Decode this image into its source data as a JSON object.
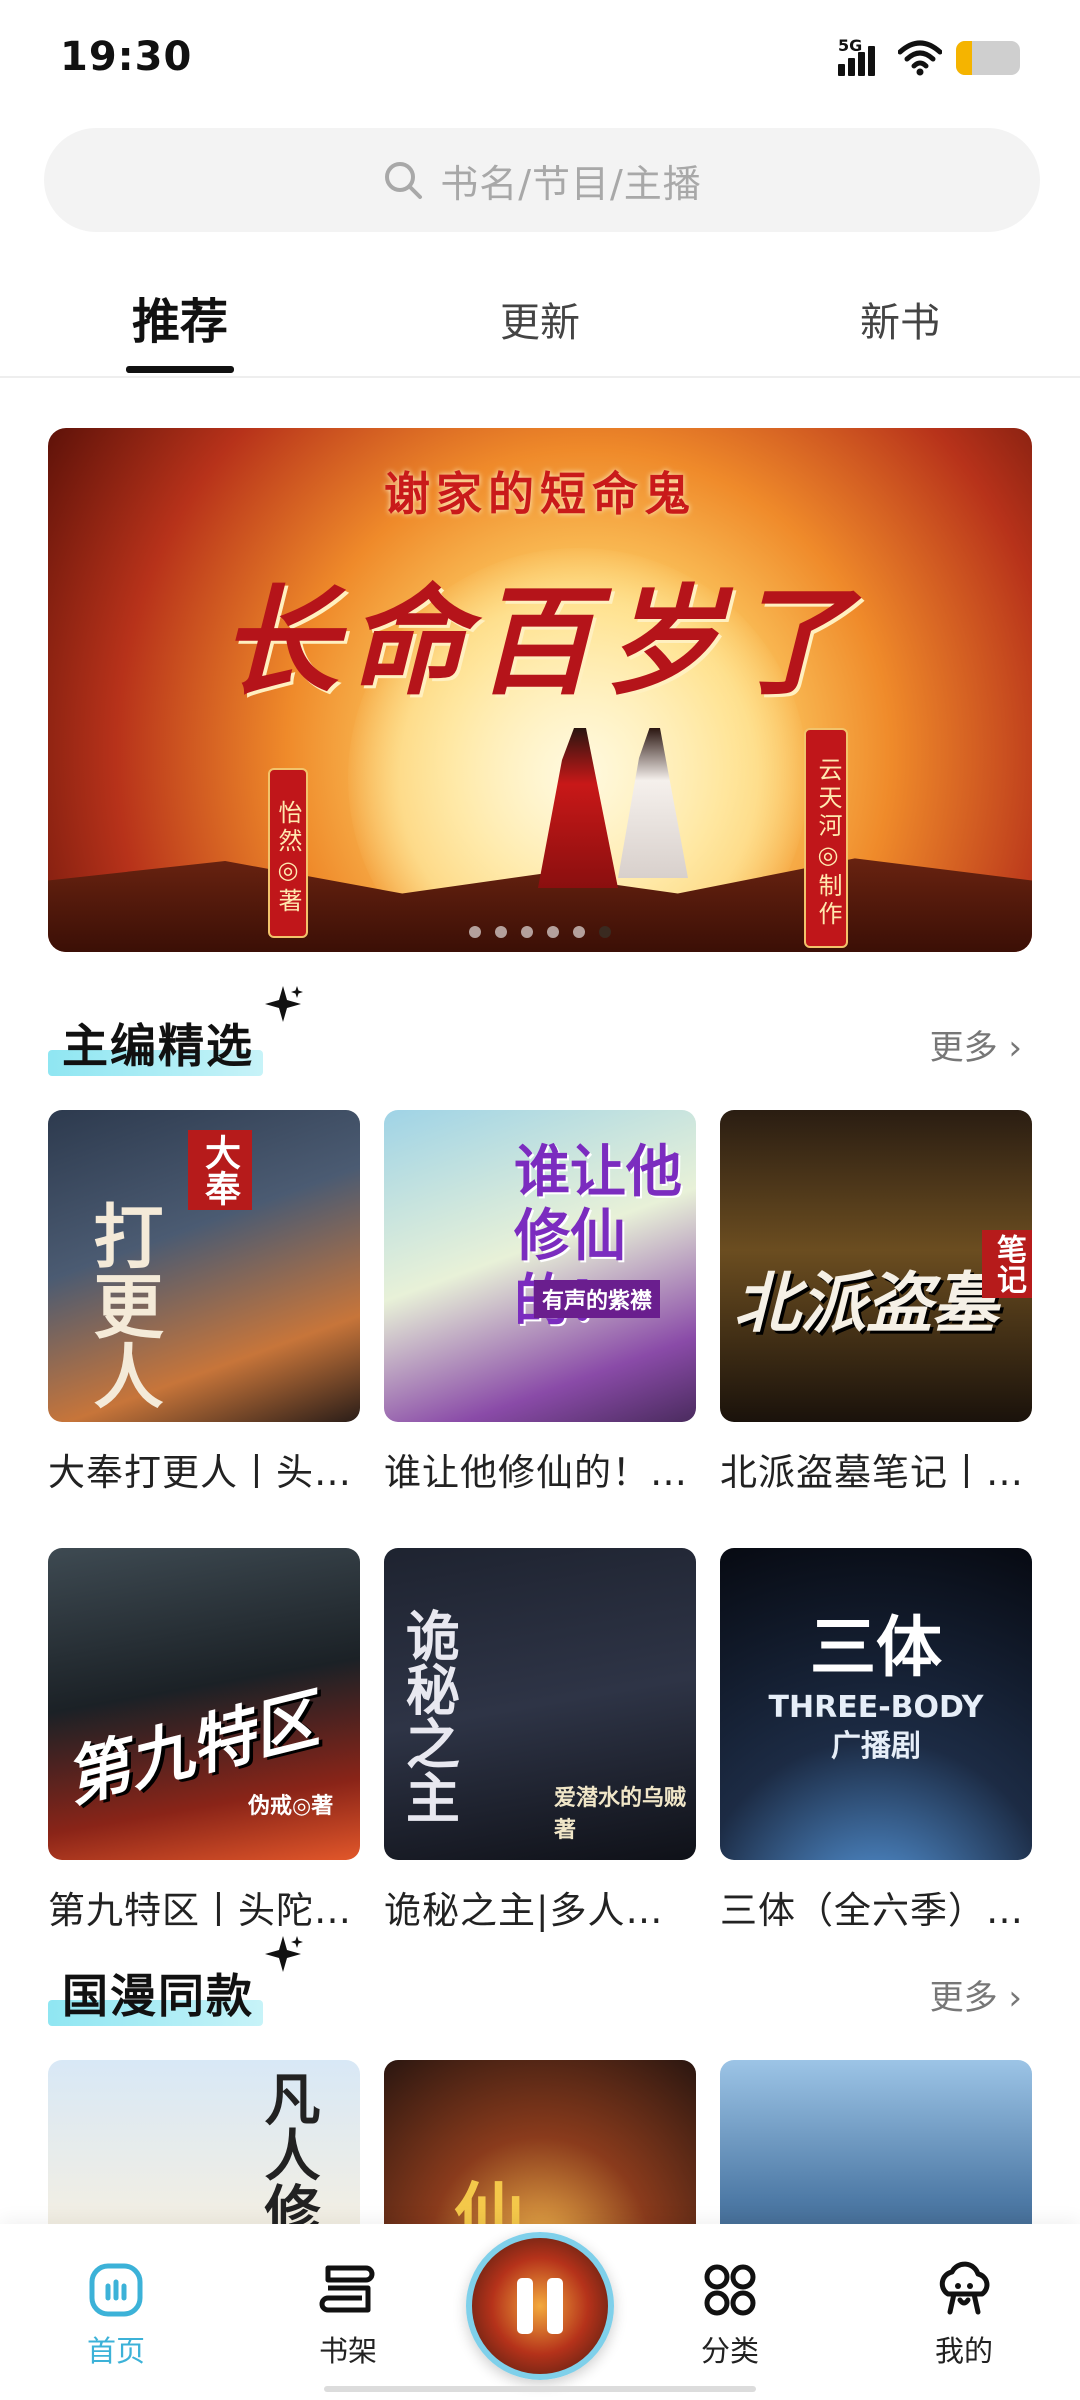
{
  "status_bar": {
    "time": "19:30",
    "network": "5G",
    "battery_level": 0.25,
    "battery_color": "#f5b400"
  },
  "search": {
    "placeholder": "书名/节目/主播",
    "icon": "search-icon"
  },
  "tabs": [
    {
      "label": "推荐",
      "active": true
    },
    {
      "label": "更新",
      "active": false
    },
    {
      "label": "新书",
      "active": false
    }
  ],
  "banner": {
    "subtitle": "谢家的短命鬼",
    "title": "长命百岁了",
    "author_tag": "怡然◎著",
    "producer_tag": "云天河◎制作",
    "slide_count": 6,
    "active_slide": 6
  },
  "sections": [
    {
      "title": "主编精选",
      "more_label": "更多",
      "items": [
        {
          "title": "大奉打更人丨头陀渊播讲",
          "cover_text": "打更人",
          "cover_sub": "大奉"
        },
        {
          "title": "谁让他修仙的！有声的紫襟",
          "cover_text": "谁让他修仙的!",
          "cover_sub": "有声的紫襟"
        },
        {
          "title": "北派盗墓笔记丨老彩",
          "cover_text": "北派盗墓",
          "cover_sub": "笔记"
        },
        {
          "title": "第九特区丨头陀渊播讲",
          "cover_text": "第九特区",
          "cover_sub": "伪戒◎著"
        },
        {
          "title": "诡秘之主|多人有声剧",
          "cover_text": "诡秘之主",
          "cover_sub": "爱潜水的乌贼著"
        },
        {
          "title": "三体（全六季）|广播剧",
          "cover_text": "三体",
          "cover_sub": "THREE-BODY 广播剧"
        }
      ]
    },
    {
      "title": "国漫同款",
      "more_label": "更多",
      "items": [
        {
          "cover_text": "凡人修仙"
        },
        {
          "cover_text": "仙"
        },
        {
          "cover_text": ""
        }
      ]
    }
  ],
  "bottom_nav": [
    {
      "label": "首页",
      "icon": "home-icon",
      "active": true
    },
    {
      "label": "书架",
      "icon": "bookshelf-icon",
      "active": false
    },
    {
      "label": "分类",
      "icon": "category-icon",
      "active": false
    },
    {
      "label": "我的",
      "icon": "profile-icon",
      "active": false
    }
  ],
  "colors": {
    "accent": "#3cb2d8",
    "highlight": "#8fe6f2"
  }
}
